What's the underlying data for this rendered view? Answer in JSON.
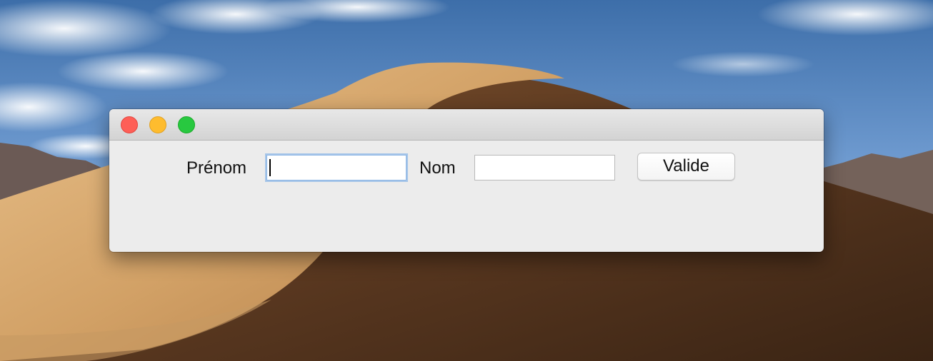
{
  "window": {
    "title": ""
  },
  "form": {
    "prenom_label": "Prénom",
    "prenom_value": "",
    "prenom_placeholder": "",
    "nom_label": "Nom",
    "nom_value": "",
    "nom_placeholder": "",
    "submit_label": "Valide"
  },
  "colors": {
    "close": "#fe5f57",
    "minimize": "#febc2e",
    "maximize": "#28c840",
    "window_bg": "#ececec",
    "focus_ring": "#8db7e6"
  },
  "icons": {
    "close": "close-icon",
    "minimize": "minimize-icon",
    "maximize": "maximize-icon"
  }
}
